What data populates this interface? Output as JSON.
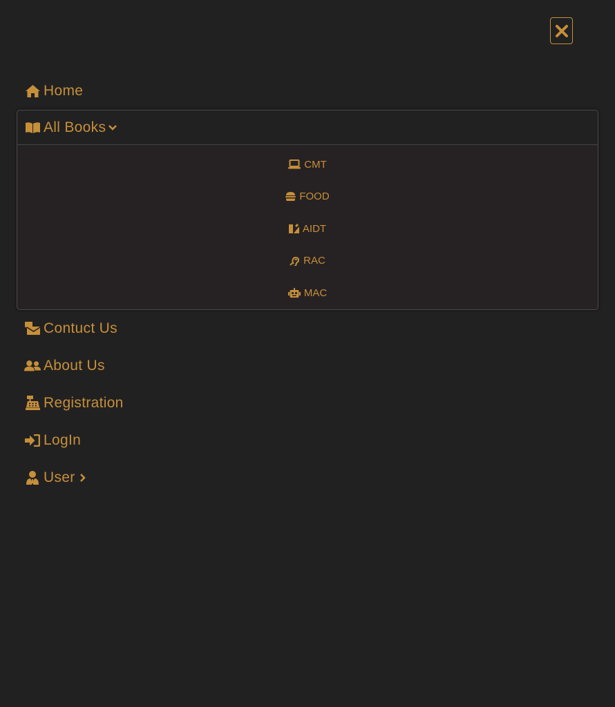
{
  "theme": {
    "background": "#212121",
    "submenu_background": "#262223",
    "accent": "#c68f3a"
  },
  "close_button": {
    "icon": "close-icon"
  },
  "nav": {
    "home": {
      "label": "Home",
      "icon": "home-icon"
    },
    "all_books": {
      "label": "All Books",
      "icon": "book-open-icon",
      "expanded": true,
      "items": [
        {
          "label": "CMT",
          "icon": "laptop-icon"
        },
        {
          "label": "FOOD",
          "icon": "hamburger-icon"
        },
        {
          "label": "AIDT",
          "icon": "drafting-tools-icon"
        },
        {
          "label": "RAC",
          "icon": "assistive-listening-icon"
        },
        {
          "label": "MAC",
          "icon": "robot-icon"
        }
      ]
    },
    "contact": {
      "label": "Contuct Us",
      "icon": "mail-bulk-icon"
    },
    "about": {
      "label": "About Us",
      "icon": "users-icon"
    },
    "registration": {
      "label": "Registration",
      "icon": "cash-register-icon"
    },
    "login": {
      "label": "LogIn",
      "icon": "sign-in-icon"
    },
    "user": {
      "label": "User",
      "icon": "user-tie-icon"
    }
  }
}
